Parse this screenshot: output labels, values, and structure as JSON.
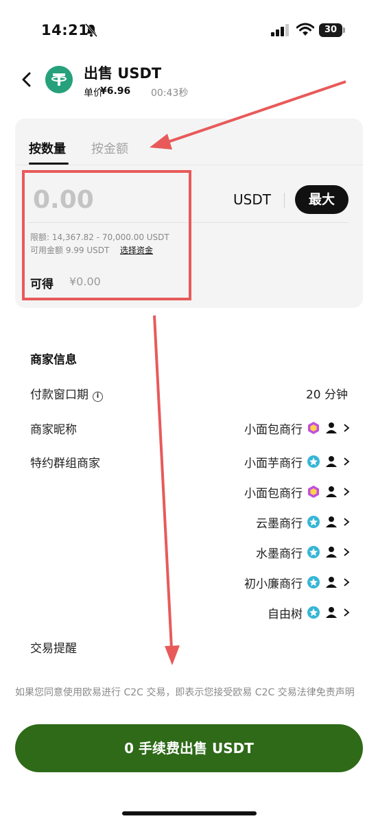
{
  "status": {
    "time": "14:21",
    "battery": "30",
    "icons": [
      "bell-muted-icon",
      "signal-icon",
      "wifi-icon",
      "battery-icon"
    ]
  },
  "header": {
    "title": "出售 USDT",
    "price_label": "单价",
    "price_value": "¥6.96",
    "timer": "00:43秒",
    "back_icon": "chevron-left-icon",
    "coin_icon": "tether-logo-icon"
  },
  "trade": {
    "tabs": [
      {
        "label": "按数量",
        "active": true
      },
      {
        "label": "按金额",
        "active": false
      }
    ],
    "amount_placeholder": "0.00",
    "unit": "USDT",
    "max_label": "最大",
    "limit_text": "限额: 14,367.82 - 70,000.00 USDT",
    "available_text": "可用金额 9.99 USDT",
    "select_funds": "选择资金",
    "receive_label": "可得",
    "receive_value": "¥0.00"
  },
  "merchant_info": {
    "title": "商家信息",
    "payment_window_label": "付款窗口期",
    "payment_window_value": "20 分钟",
    "nickname_label": "商家昵称",
    "nickname_value": "小面包商行",
    "group_label": "特约群组商家",
    "group_merchants": [
      {
        "name": "小面芋商行",
        "badge": "star-badge-icon"
      },
      {
        "name": "小面包商行",
        "badge": "hexagon-badge-icon"
      },
      {
        "name": "云墨商行",
        "badge": "star-badge-icon"
      },
      {
        "name": "水墨商行",
        "badge": "star-badge-icon"
      },
      {
        "name": "初小廉商行",
        "badge": "star-badge-icon"
      },
      {
        "name": "自由树",
        "badge": "star-badge-icon"
      }
    ],
    "reminder_label": "交易提醒"
  },
  "footer": {
    "disclaimer": "如果您同意使用欧易进行 C2C 交易，即表示您接受欧易 C2C 交易法律免责声明",
    "sell_button": "0 手续费出售 USDT"
  },
  "colors": {
    "sell_button": "#2e6a18",
    "annotation": "#e85a5a",
    "tether": "#26a17b",
    "star_badge": "#36b6d6",
    "hexagon_badge": "#c050e0"
  }
}
